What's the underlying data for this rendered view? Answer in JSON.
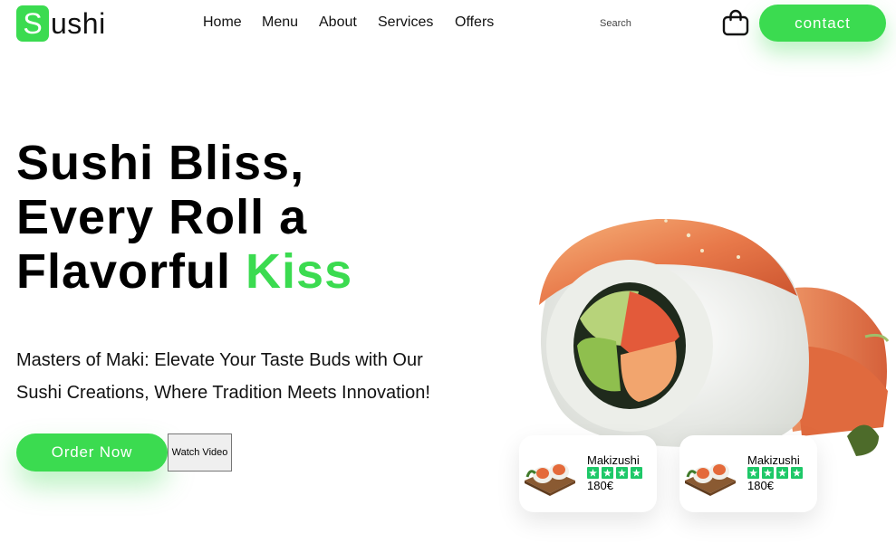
{
  "brand": {
    "mark": "S",
    "rest": "ushi"
  },
  "nav": [
    "Home",
    "Menu",
    "About",
    "Services",
    "Offers"
  ],
  "search": {
    "placeholder": "Search",
    "value": ""
  },
  "header": {
    "contact_label": "contact",
    "cart_icon": "shopping-bag-icon"
  },
  "hero": {
    "title_line1": "Sushi Bliss,",
    "title_line2": "Every Roll a",
    "title_line3_plain": "Flavorful",
    "title_line3_accent": "Kiss",
    "subtitle_line1": "Masters of Maki: Elevate Your Taste Buds with Our",
    "subtitle_line2": "Sushi Creations, Where Tradition Meets Innovation!",
    "order_label": "Order Now",
    "watch_label": "Watch Video"
  },
  "cards": [
    {
      "name": "Makizushi",
      "rating": 4,
      "price": "180€"
    },
    {
      "name": "Makizushi",
      "rating": 4,
      "price": "180€"
    }
  ],
  "colors": {
    "accent": "#3bdb50",
    "star": "#1ec868",
    "text": "#111111"
  }
}
